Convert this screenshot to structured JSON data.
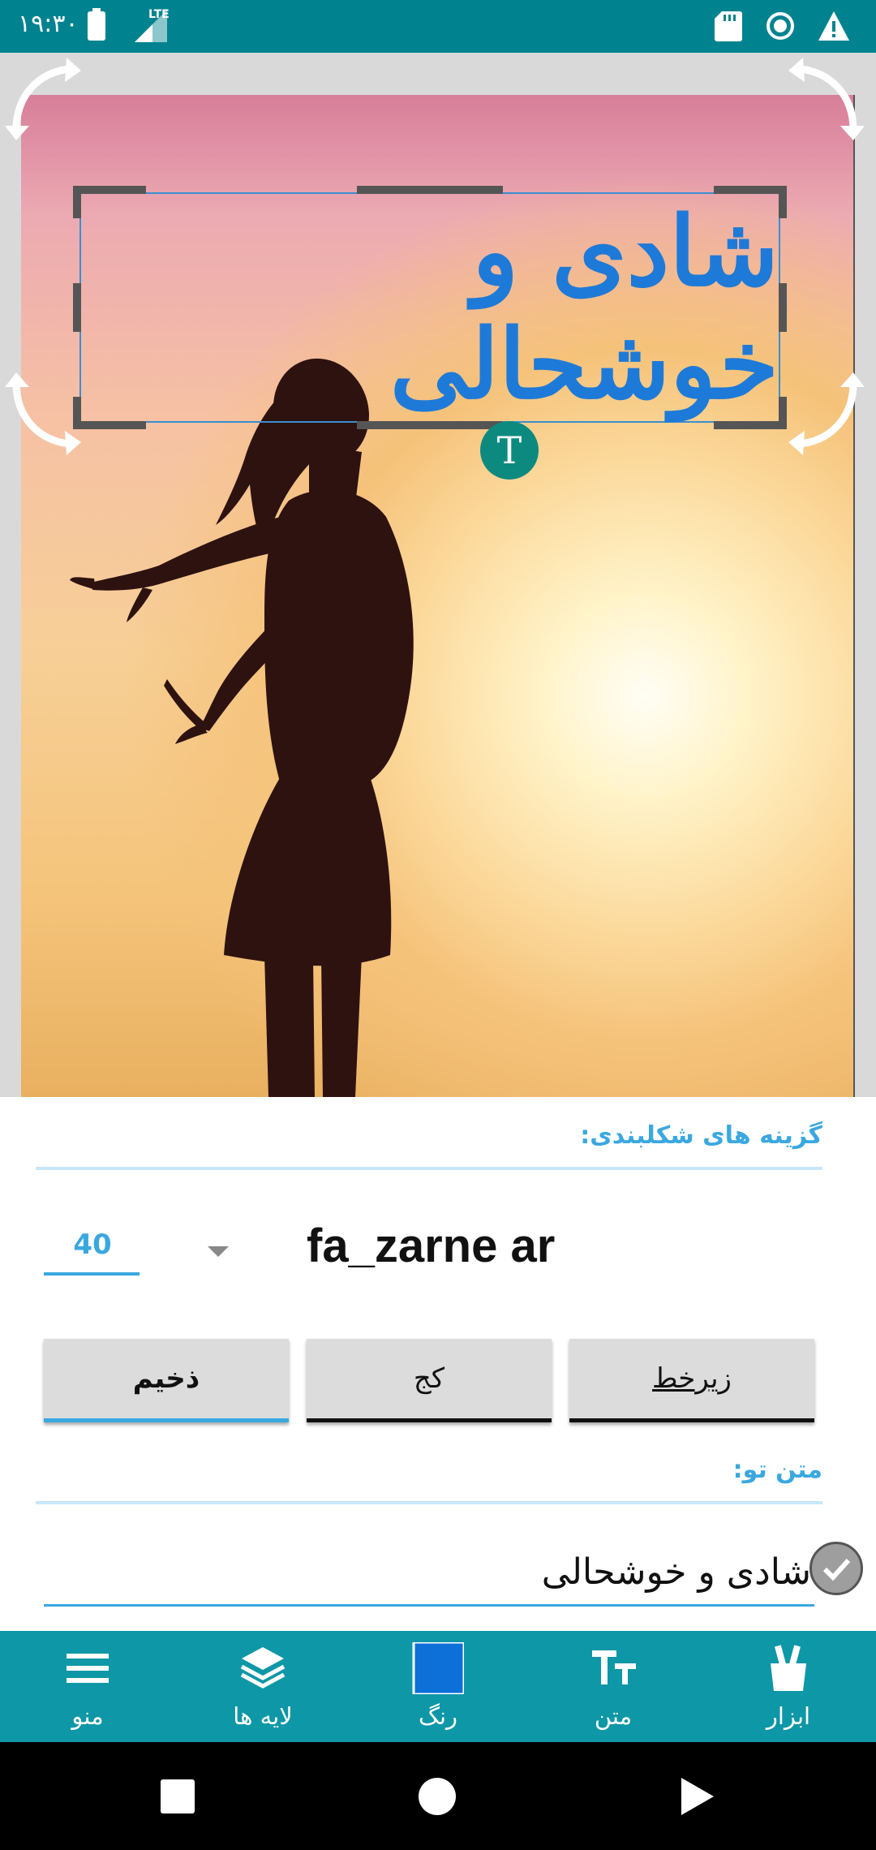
{
  "status_bar": {
    "time": "۱۹:۳۰",
    "network": "LTE",
    "icons": [
      "battery-icon",
      "signal-lte-icon",
      "sd-card-icon",
      "sync-circle-icon",
      "warning-icon"
    ]
  },
  "canvas": {
    "overlay_text": "شادی و خوشحالی",
    "overlay_text_color": "#1e7ad8",
    "handle_glyph": "T",
    "handle_color": "#0d8a80",
    "rotate_icons": [
      "rotate-top-left-icon",
      "rotate-top-right-icon",
      "rotate-bottom-left-icon",
      "rotate-bottom-right-icon"
    ]
  },
  "panel": {
    "format_title": "گزینه های شکلبندی:",
    "font_size": "40",
    "font_name": "fa_zarne ar",
    "buttons": {
      "underline": "زیرخط",
      "italic": "کج",
      "save": "ذخیم"
    },
    "text_title": "متن تو:",
    "text_value": "شادی و خوشحالی"
  },
  "toolbar": {
    "items": [
      {
        "label": "منو",
        "icon": "menu-icon"
      },
      {
        "label": "لایه ها",
        "icon": "layers-icon"
      },
      {
        "label": "رنگ",
        "icon": "color-swatch-icon"
      },
      {
        "label": "متن",
        "icon": "text-size-icon"
      },
      {
        "label": "ابزار",
        "icon": "tools-icon"
      }
    ],
    "selected_color": "#0d6fd8",
    "background": "#0e97a6"
  },
  "nav": {
    "icons": [
      "recents-square-icon",
      "home-circle-icon",
      "back-triangle-icon"
    ]
  },
  "colors": {
    "accent": "#3aa8df",
    "status_bar": "#00838f"
  }
}
